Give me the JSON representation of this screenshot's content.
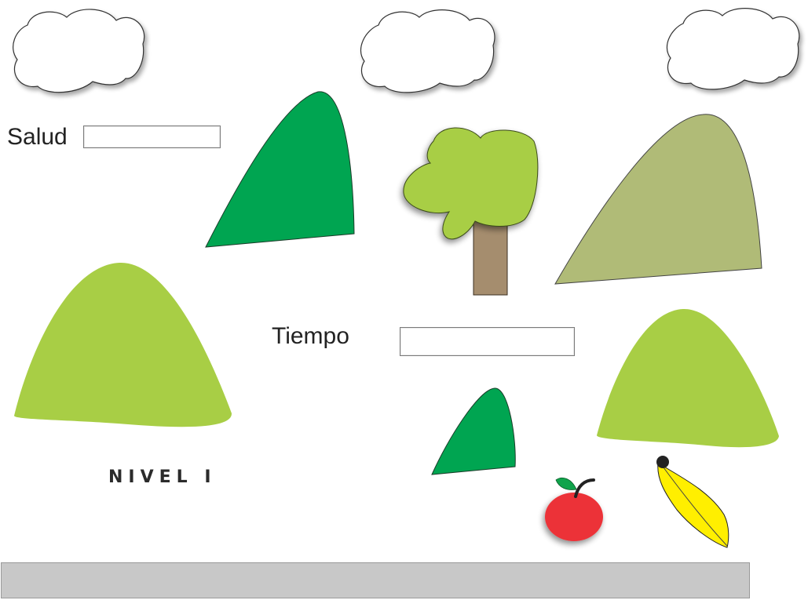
{
  "hud": {
    "health_label": "Salud",
    "time_label": "Tiempo"
  },
  "level": {
    "title": "NIVEL I"
  },
  "colors": {
    "bush_dark_green": "#00a551",
    "bush_light_green": "#a8ce45",
    "mountain_olive": "#b0bb77",
    "tree_canopy": "#a8ce45",
    "tree_trunk": "#a58d6e",
    "apple_red": "#ec3237",
    "banana_yellow": "#ffef00",
    "cloud_fill": "#ffffff",
    "ground_gray": "#c8c8c8"
  },
  "icons": [
    "cloud-icon",
    "tree-icon",
    "apple-icon",
    "banana-icon",
    "bush-icon",
    "mountain-icon"
  ]
}
